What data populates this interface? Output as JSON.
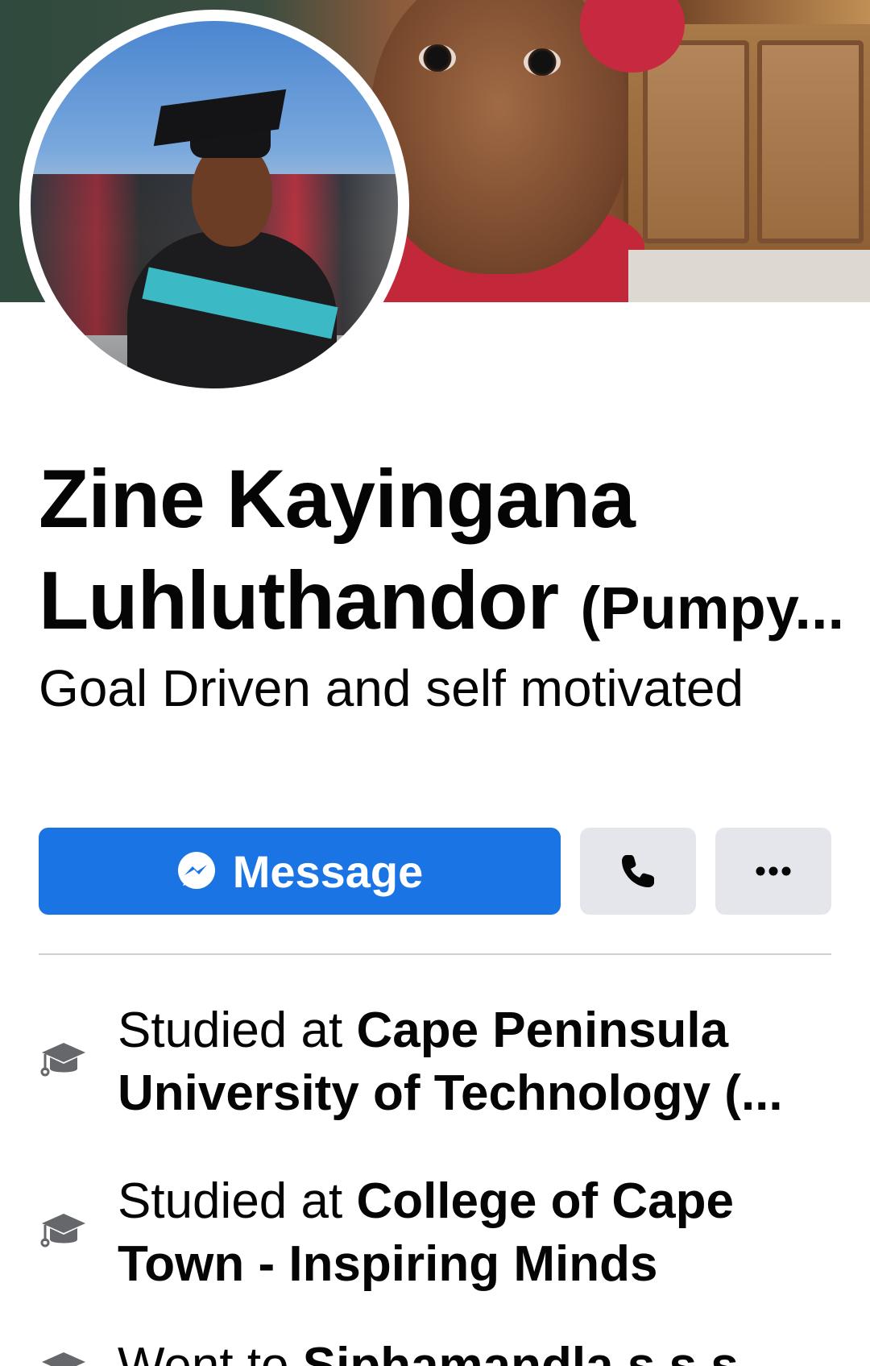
{
  "profile": {
    "name_line1": "Zine Kayingana",
    "name_line2": "Luhluthandor",
    "nickname": "(Pumpy...",
    "bio": "Goal Driven and self motivated"
  },
  "actions": {
    "message_label": "Message",
    "message_icon": "messenger-icon",
    "call_icon": "phone-icon",
    "more_icon": "more-dots-icon",
    "primary_color": "#1b74e4",
    "secondary_color": "#e4e6eb"
  },
  "intro": {
    "items": [
      {
        "icon": "graduation-cap-icon",
        "prefix": "Studied at ",
        "bold_line1": "Cape Peninsula",
        "bold_line2": "University of Technology (..."
      },
      {
        "icon": "graduation-cap-icon",
        "prefix": "Studied at ",
        "bold_line1": "College of Cape",
        "bold_line2": "Town - Inspiring Minds"
      },
      {
        "icon": "graduation-cap-icon",
        "prefix": "Went to ",
        "bold_line1": "Siphamandla s.s.s"
      }
    ]
  }
}
